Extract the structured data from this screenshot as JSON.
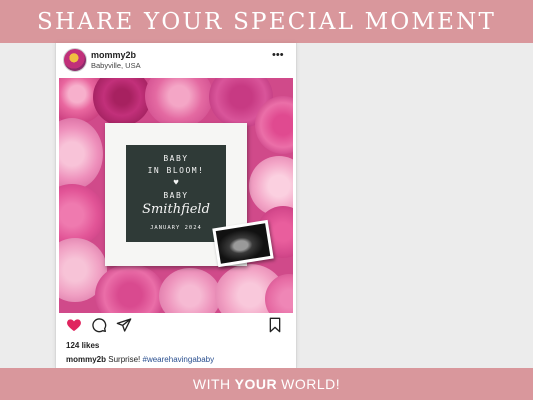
{
  "banner": {
    "headline": "SHARE YOUR SPECIAL MOMENT",
    "tagline_before": "WITH",
    "tagline_emphasis": "YOUR",
    "tagline_after": "WORLD!"
  },
  "post": {
    "username": "mommy2b",
    "location": "Babyville, USA",
    "more_icon": "more-options-icon",
    "image": {
      "board_line1": "BABY",
      "board_line2": "IN BLOOM!",
      "board_heart": "♥",
      "board_line3": "BABY",
      "board_name": "Smithfield",
      "board_date": "JANUARY 2024"
    },
    "actions": {
      "like_icon": "heart-icon",
      "comment_icon": "comment-icon",
      "share_icon": "share-icon",
      "save_icon": "bookmark-icon"
    },
    "likes": "124 likes",
    "caption_user": "mommy2b",
    "caption_text": "Surprise!",
    "caption_hashtag": "#wearehavingababy"
  },
  "colors": {
    "banner": "#d9979c",
    "like_heart": "#e0245e",
    "hashtag": "#2a4f8f",
    "letterboard": "#2f3a37"
  }
}
